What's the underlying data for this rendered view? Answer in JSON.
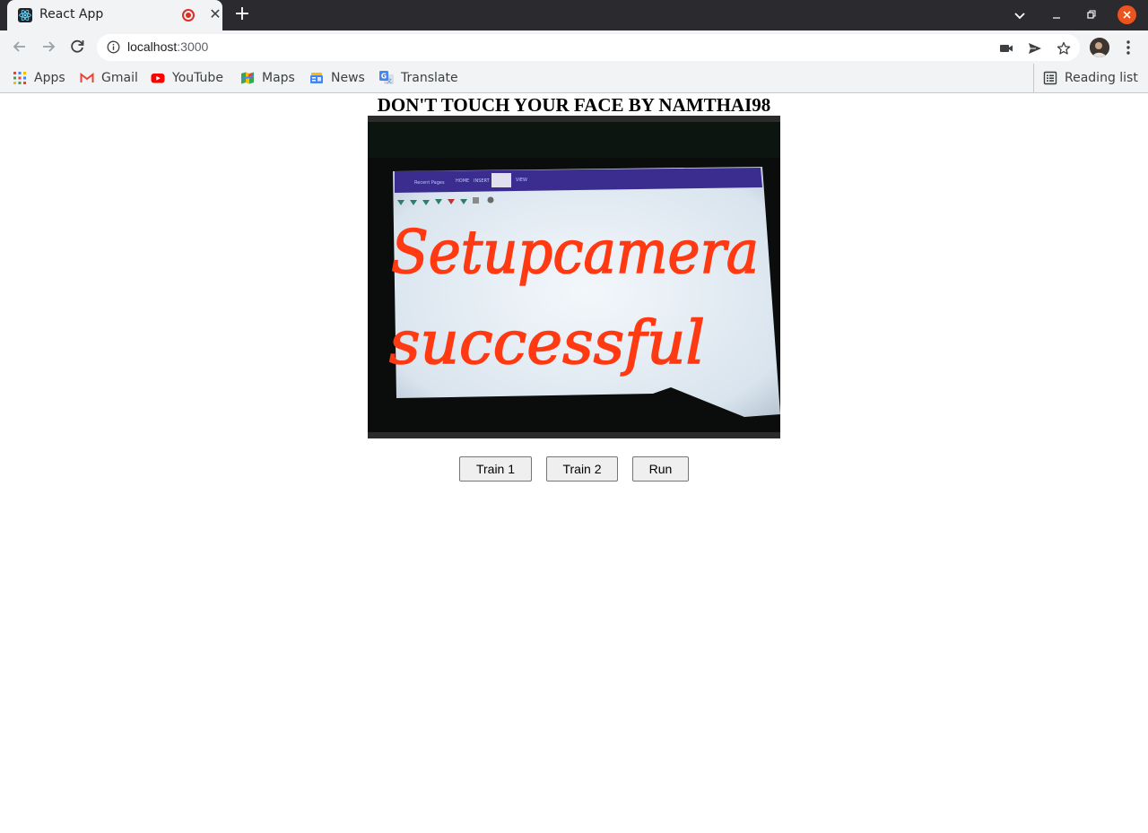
{
  "browser": {
    "tab_title": "React App",
    "url_host": "localhost",
    "url_port": ":3000"
  },
  "bookmarks": {
    "items": [
      {
        "label": "Apps",
        "icon": "apps-grid-icon"
      },
      {
        "label": "Gmail",
        "icon": "gmail-icon"
      },
      {
        "label": "YouTube",
        "icon": "youtube-icon"
      },
      {
        "label": "Maps",
        "icon": "maps-icon"
      },
      {
        "label": "News",
        "icon": "news-icon"
      },
      {
        "label": "Translate",
        "icon": "translate-icon"
      }
    ],
    "reading_list": "Reading list"
  },
  "page": {
    "title": "DON'T TOUCH YOUR FACE BY NAMTHAI98",
    "video_text_line1": "Setupcamera",
    "video_text_line2": "successful",
    "buttons": {
      "train1": "Train 1",
      "train2": "Train 2",
      "run": "Run"
    }
  },
  "colors": {
    "tabbar_bg": "#2b2a2e",
    "chrome_bg": "#f1f3f4",
    "close_button": "#e95420",
    "recording": "#d93025",
    "handwriting": "#ff3a12"
  }
}
